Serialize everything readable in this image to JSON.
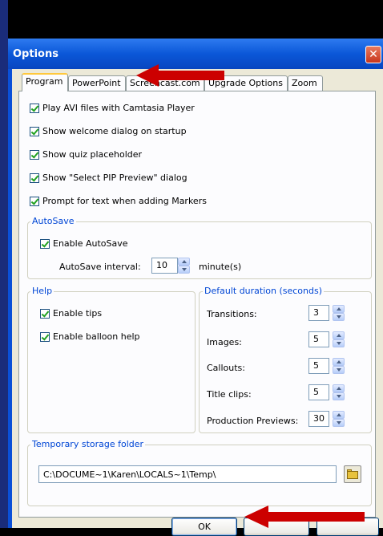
{
  "window": {
    "title": "Options",
    "close_symbol": "✕"
  },
  "tabs": [
    {
      "label": "Program",
      "active": true
    },
    {
      "label": "PowerPoint",
      "active": false
    },
    {
      "label": "Screencast.com",
      "active": false
    },
    {
      "label": "Upgrade Options",
      "active": false
    },
    {
      "label": "Zoom",
      "active": false
    }
  ],
  "program": {
    "checkboxes": [
      {
        "label": "Play AVI files with Camtasia Player",
        "checked": true
      },
      {
        "label": "Show welcome dialog on startup",
        "checked": true
      },
      {
        "label": "Show quiz placeholder",
        "checked": true
      },
      {
        "label": "Show \"Select PIP Preview\" dialog",
        "checked": true
      },
      {
        "label": "Prompt for text when adding Markers",
        "checked": true
      }
    ],
    "autosave": {
      "title": "AutoSave",
      "enable_label": "Enable AutoSave",
      "enabled": true,
      "interval_label": "AutoSave interval:",
      "interval_value": "10",
      "interval_unit": "minute(s)"
    },
    "help": {
      "title": "Help",
      "tips_label": "Enable tips",
      "tips_checked": true,
      "balloon_label": "Enable balloon help",
      "balloon_checked": true
    },
    "durations": {
      "title": "Default duration (seconds)",
      "items": [
        {
          "label": "Transitions:",
          "value": "3"
        },
        {
          "label": "Images:",
          "value": "5"
        },
        {
          "label": "Callouts:",
          "value": "5"
        },
        {
          "label": "Title clips:",
          "value": "5"
        },
        {
          "label": "Production Previews:",
          "value": "30"
        }
      ]
    },
    "storage": {
      "title": "Temporary storage folder",
      "path": "C:\\DOCUME~1\\Karen\\LOCALS~1\\Temp\\"
    }
  },
  "buttons": {
    "ok_label": "OK",
    "cancel_label": ""
  },
  "colors": {
    "annotation_arrow": "#cc0000",
    "title_bar": "#0b57d8",
    "group_title": "#0046d5",
    "check_mark": "#21a121"
  },
  "icons": {
    "close": "close-icon",
    "folder": "folder-icon",
    "spin_up": "spin-up-icon",
    "spin_down": "spin-down-icon",
    "arrow": "annotation-arrow-icon"
  }
}
